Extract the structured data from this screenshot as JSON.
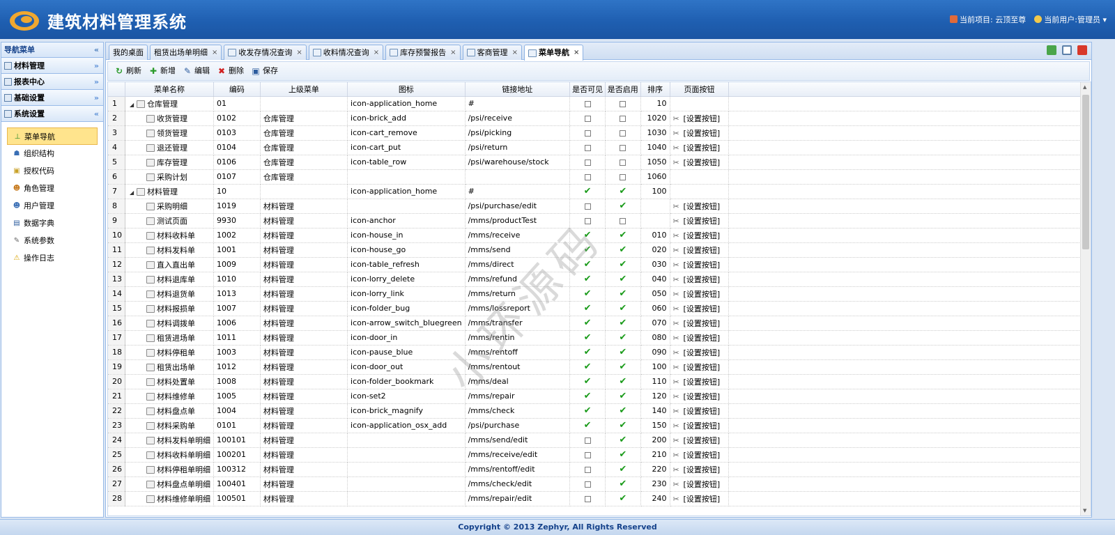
{
  "header": {
    "title": "建筑材料管理系统",
    "project_label": "当前项目: 云顶至尊",
    "user_label": "当前用户:管理员"
  },
  "sidebar": {
    "title": "导航菜单",
    "collapse_glyph": "«",
    "sections": [
      {
        "label": "材料管理",
        "glyph": "»"
      },
      {
        "label": "报表中心",
        "glyph": "»"
      },
      {
        "label": "基础设置",
        "glyph": "»"
      },
      {
        "label": "系统设置",
        "glyph": "«"
      }
    ],
    "items": [
      {
        "label": "菜单导航",
        "icon": "sitemap-icon",
        "glyph": "⊥",
        "color": "#2a8a2a"
      },
      {
        "label": "组织结构",
        "icon": "org-icon",
        "glyph": "☗",
        "color": "#3a6fb5"
      },
      {
        "label": "授权代码",
        "icon": "lock-icon",
        "glyph": "▣",
        "color": "#c9a22a"
      },
      {
        "label": "角色管理",
        "icon": "role-icon",
        "glyph": "☻",
        "color": "#c77a1e"
      },
      {
        "label": "用户管理",
        "icon": "users-icon",
        "glyph": "☻",
        "color": "#3a6fb5"
      },
      {
        "label": "数据字典",
        "icon": "book-icon",
        "glyph": "▤",
        "color": "#2d5c9e"
      },
      {
        "label": "系统参数",
        "icon": "wrench-icon",
        "glyph": "✎",
        "color": "#666"
      },
      {
        "label": "操作日志",
        "icon": "warning-icon",
        "glyph": "⚠",
        "color": "#d9a300"
      }
    ]
  },
  "tabs": [
    {
      "label": "我的桌面",
      "closable": false
    },
    {
      "label": "租赁出场单明细",
      "closable": true
    },
    {
      "label": "收发存情况查询",
      "closable": true
    },
    {
      "label": "收料情况查询",
      "closable": true
    },
    {
      "label": "库存预警报告",
      "closable": true
    },
    {
      "label": "客商管理",
      "closable": true
    },
    {
      "label": "菜单导航",
      "closable": true,
      "active": true
    }
  ],
  "toolbar": [
    {
      "label": "刷新",
      "glyph": "↻",
      "color": "#2a9a2a"
    },
    {
      "label": "新增",
      "glyph": "✚",
      "color": "#2a9a2a"
    },
    {
      "label": "编辑",
      "glyph": "✎",
      "color": "#2d5c9e"
    },
    {
      "label": "删除",
      "glyph": "✖",
      "color": "#d02020"
    },
    {
      "label": "保存",
      "glyph": "▣",
      "color": "#2d5c9e"
    }
  ],
  "grid": {
    "columns": [
      "",
      "菜单名称",
      "编码",
      "上级菜单",
      "图标",
      "链接地址",
      "是否可见",
      "是否启用",
      "排序",
      "页面按钮"
    ],
    "button_label": "[设置按钮]",
    "rows": [
      {
        "n": "1",
        "name": "仓库管理",
        "code": "01",
        "parent": "",
        "icon": "icon-application_home",
        "url": "#",
        "vis": false,
        "en": false,
        "sort": "10",
        "btn": false,
        "level": 0,
        "exp": true
      },
      {
        "n": "2",
        "name": "收货管理",
        "code": "0102",
        "parent": "仓库管理",
        "icon": "icon-brick_add",
        "url": "/psi/receive",
        "vis": false,
        "en": false,
        "sort": "1020",
        "btn": true,
        "level": 1
      },
      {
        "n": "3",
        "name": "领货管理",
        "code": "0103",
        "parent": "仓库管理",
        "icon": "icon-cart_remove",
        "url": "/psi/picking",
        "vis": false,
        "en": false,
        "sort": "1030",
        "btn": true,
        "level": 1
      },
      {
        "n": "4",
        "name": "退还管理",
        "code": "0104",
        "parent": "仓库管理",
        "icon": "icon-cart_put",
        "url": "/psi/return",
        "vis": false,
        "en": false,
        "sort": "1040",
        "btn": true,
        "level": 1
      },
      {
        "n": "5",
        "name": "库存管理",
        "code": "0106",
        "parent": "仓库管理",
        "icon": "icon-table_row",
        "url": "/psi/warehouse/stock",
        "vis": false,
        "en": false,
        "sort": "1050",
        "btn": true,
        "level": 1
      },
      {
        "n": "6",
        "name": "采购计划",
        "code": "0107",
        "parent": "仓库管理",
        "icon": "",
        "url": "",
        "vis": false,
        "en": false,
        "sort": "1060",
        "btn": false,
        "level": 1
      },
      {
        "n": "7",
        "name": "材料管理",
        "code": "10",
        "parent": "",
        "icon": "icon-application_home",
        "url": "#",
        "vis": true,
        "en": true,
        "sort": "100",
        "btn": false,
        "level": 0,
        "exp": true
      },
      {
        "n": "8",
        "name": "采购明细",
        "code": "1019",
        "parent": "材料管理",
        "icon": "",
        "url": "/psi/purchase/edit",
        "vis": false,
        "en": true,
        "sort": "",
        "btn": true,
        "level": 1
      },
      {
        "n": "9",
        "name": "测试页面",
        "code": "9930",
        "parent": "材料管理",
        "icon": "icon-anchor",
        "url": "/mms/productTest",
        "vis": false,
        "en": false,
        "sort": "",
        "btn": true,
        "level": 1
      },
      {
        "n": "10",
        "name": "材料收料单",
        "code": "1002",
        "parent": "材料管理",
        "icon": "icon-house_in",
        "url": "/mms/receive",
        "vis": true,
        "en": true,
        "sort": "010",
        "btn": true,
        "level": 1
      },
      {
        "n": "11",
        "name": "材料发料单",
        "code": "1001",
        "parent": "材料管理",
        "icon": "icon-house_go",
        "url": "/mms/send",
        "vis": true,
        "en": true,
        "sort": "020",
        "btn": true,
        "level": 1
      },
      {
        "n": "12",
        "name": "直入直出单",
        "code": "1009",
        "parent": "材料管理",
        "icon": "icon-table_refresh",
        "url": "/mms/direct",
        "vis": true,
        "en": true,
        "sort": "030",
        "btn": true,
        "level": 1
      },
      {
        "n": "13",
        "name": "材料退库单",
        "code": "1010",
        "parent": "材料管理",
        "icon": "icon-lorry_delete",
        "url": "/mms/refund",
        "vis": true,
        "en": true,
        "sort": "040",
        "btn": true,
        "level": 1
      },
      {
        "n": "14",
        "name": "材料退货单",
        "code": "1013",
        "parent": "材料管理",
        "icon": "icon-lorry_link",
        "url": "/mms/return",
        "vis": true,
        "en": true,
        "sort": "050",
        "btn": true,
        "level": 1
      },
      {
        "n": "15",
        "name": "材料报损单",
        "code": "1007",
        "parent": "材料管理",
        "icon": "icon-folder_bug",
        "url": "/mms/lossreport",
        "vis": true,
        "en": true,
        "sort": "060",
        "btn": true,
        "level": 1
      },
      {
        "n": "16",
        "name": "材料调拨单",
        "code": "1006",
        "parent": "材料管理",
        "icon": "icon-arrow_switch_bluegreen",
        "url": "/mms/transfer",
        "vis": true,
        "en": true,
        "sort": "070",
        "btn": true,
        "level": 1
      },
      {
        "n": "17",
        "name": "租赁进场单",
        "code": "1011",
        "parent": "材料管理",
        "icon": "icon-door_in",
        "url": "/mms/rentin",
        "vis": true,
        "en": true,
        "sort": "080",
        "btn": true,
        "level": 1
      },
      {
        "n": "18",
        "name": "材料停租单",
        "code": "1003",
        "parent": "材料管理",
        "icon": "icon-pause_blue",
        "url": "/mms/rentoff",
        "vis": true,
        "en": true,
        "sort": "090",
        "btn": true,
        "level": 1
      },
      {
        "n": "19",
        "name": "租赁出场单",
        "code": "1012",
        "parent": "材料管理",
        "icon": "icon-door_out",
        "url": "/mms/rentout",
        "vis": true,
        "en": true,
        "sort": "100",
        "btn": true,
        "level": 1
      },
      {
        "n": "20",
        "name": "材料处置单",
        "code": "1008",
        "parent": "材料管理",
        "icon": "icon-folder_bookmark",
        "url": "/mms/deal",
        "vis": true,
        "en": true,
        "sort": "110",
        "btn": true,
        "level": 1
      },
      {
        "n": "21",
        "name": "材料维修单",
        "code": "1005",
        "parent": "材料管理",
        "icon": "icon-set2",
        "url": "/mms/repair",
        "vis": true,
        "en": true,
        "sort": "120",
        "btn": true,
        "level": 1
      },
      {
        "n": "22",
        "name": "材料盘点单",
        "code": "1004",
        "parent": "材料管理",
        "icon": "icon-brick_magnify",
        "url": "/mms/check",
        "vis": true,
        "en": true,
        "sort": "140",
        "btn": true,
        "level": 1
      },
      {
        "n": "23",
        "name": "材料采购单",
        "code": "0101",
        "parent": "材料管理",
        "icon": "icon-application_osx_add",
        "url": "/psi/purchase",
        "vis": true,
        "en": true,
        "sort": "150",
        "btn": true,
        "level": 1
      },
      {
        "n": "24",
        "name": "材料发料单明细",
        "code": "100101",
        "parent": "材料管理",
        "icon": "",
        "url": "/mms/send/edit",
        "vis": false,
        "en": true,
        "sort": "200",
        "btn": true,
        "level": 1
      },
      {
        "n": "25",
        "name": "材料收料单明细",
        "code": "100201",
        "parent": "材料管理",
        "icon": "",
        "url": "/mms/receive/edit",
        "vis": false,
        "en": true,
        "sort": "210",
        "btn": true,
        "level": 1
      },
      {
        "n": "26",
        "name": "材料停租单明细",
        "code": "100312",
        "parent": "材料管理",
        "icon": "",
        "url": "/mms/rentoff/edit",
        "vis": false,
        "en": true,
        "sort": "220",
        "btn": true,
        "level": 1
      },
      {
        "n": "27",
        "name": "材料盘点单明细",
        "code": "100401",
        "parent": "材料管理",
        "icon": "",
        "url": "/mms/check/edit",
        "vis": false,
        "en": true,
        "sort": "230",
        "btn": true,
        "level": 1
      },
      {
        "n": "28",
        "name": "材料维修单明细",
        "code": "100501",
        "parent": "材料管理",
        "icon": "",
        "url": "/mms/repair/edit",
        "vis": false,
        "en": true,
        "sort": "240",
        "btn": true,
        "level": 1
      }
    ]
  },
  "watermark": "小环源码",
  "footer": "Copyright © 2013 Zephyr, All Rights Reserved"
}
